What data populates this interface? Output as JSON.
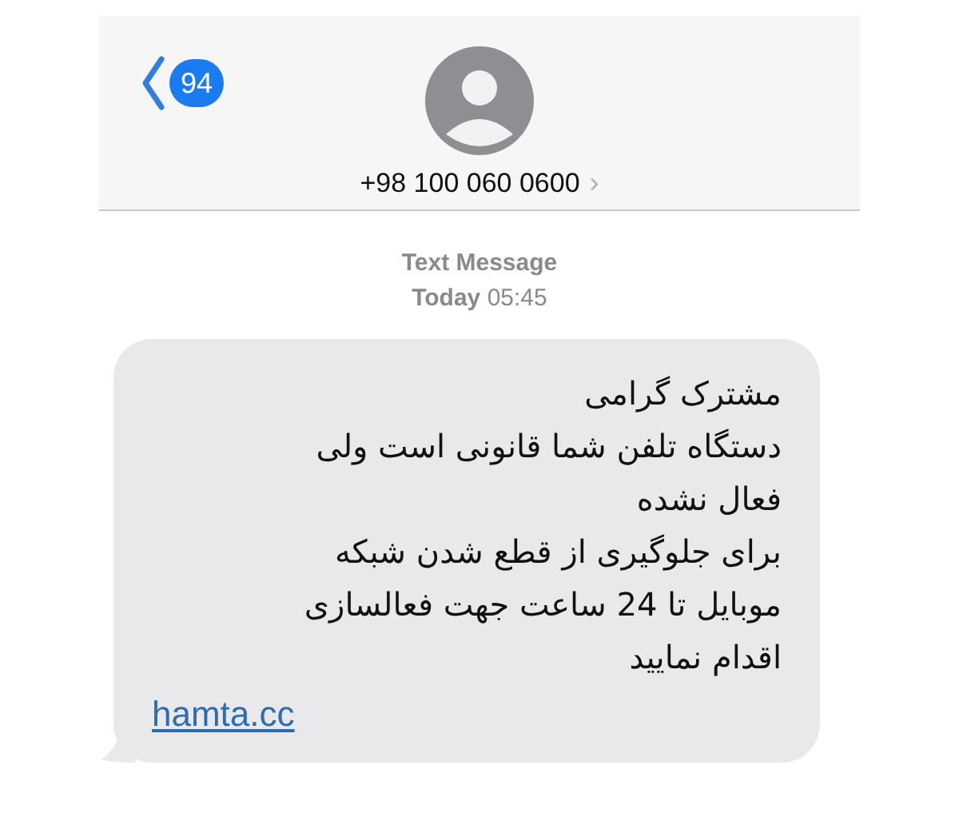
{
  "header": {
    "back_badge": "94",
    "contact": "+98 100 060 0600",
    "contact_chevron": "›"
  },
  "thread_meta": {
    "service": "Text Message",
    "day": "Today",
    "time": "05:45"
  },
  "message": {
    "text": "مشترک گرامی\nدستگاه تلفن شما قانونی است ولی\nفعال نشده\nبرای جلوگیری از قطع شدن شبکه\nموبایل تا 24 ساعت جهت فعالسازی\nاقدام نمایید",
    "link": "hamta.cc"
  }
}
